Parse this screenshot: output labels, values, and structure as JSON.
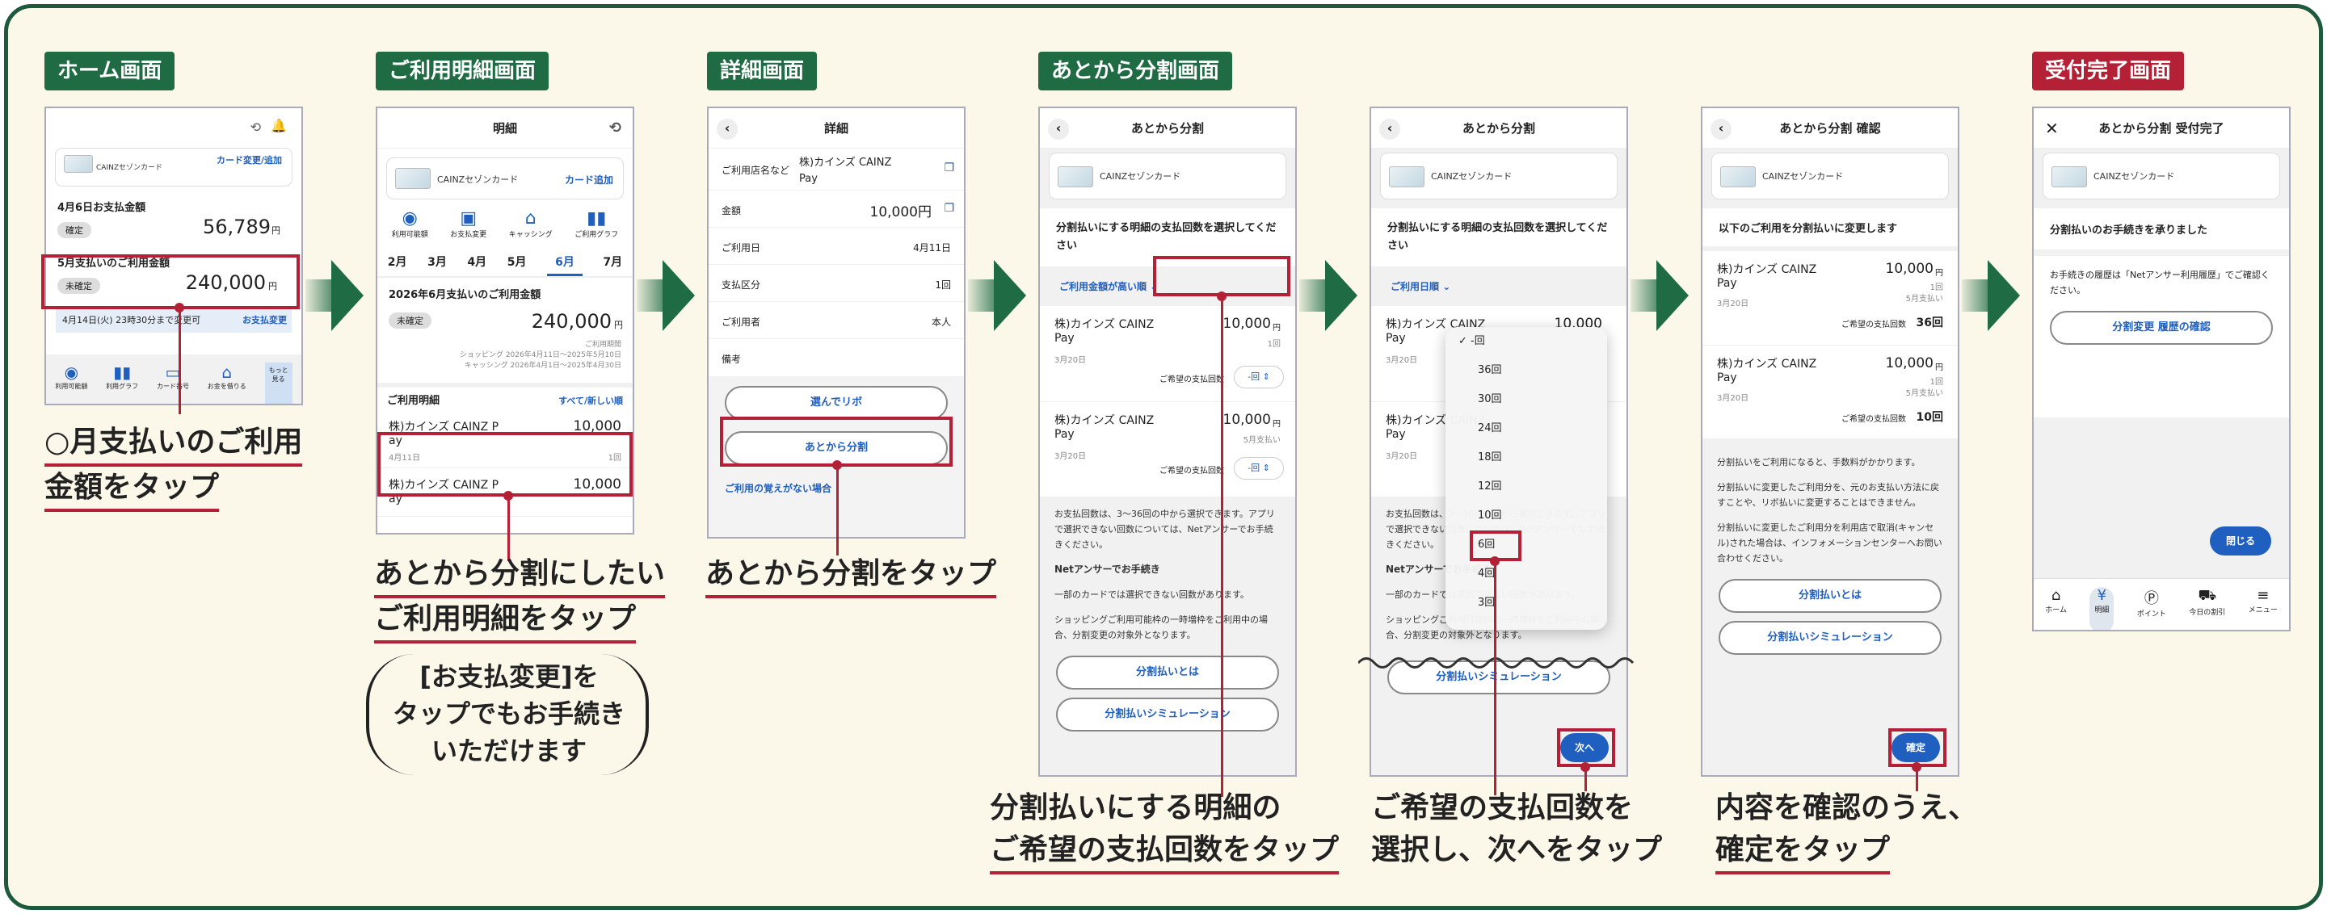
{
  "steps": [
    {
      "tag": "ホーム画面"
    },
    {
      "tag": "ご利用明細画面"
    },
    {
      "tag": "詳細画面"
    },
    {
      "tag": "あとから分割画面"
    },
    {
      "tag": ""
    },
    {
      "tag": ""
    },
    {
      "tag": "受付完了画面"
    }
  ],
  "home": {
    "card_name": "CAINZセゾンカード",
    "card_action": "カード変更/追加",
    "pay1_label": "4月6日お支払金額",
    "pay1_status": "確定",
    "pay1_amount": "56,789",
    "yen": "円",
    "pay2_label": "5月支払いのご利用金額",
    "pay2_status": "未確定",
    "pay2_amount": "240,000",
    "deadline": "4月14日(火) 23時30分まで変更可",
    "deadline_link": "お支払変更",
    "shortcuts": [
      "利用可能額",
      "利用グラフ",
      "カード番号",
      "お金を借りる",
      "もっと見る"
    ]
  },
  "list": {
    "title": "明細",
    "card_name": "CAINZセゾンカード",
    "card_add": "カード追加",
    "icons": [
      "利用可能額",
      "お支払変更",
      "キャッシング",
      "ご利用グラフ"
    ],
    "months": [
      "2月",
      "3月",
      "4月",
      "5月",
      "6月",
      "7月"
    ],
    "summary_title": "2026年6月支払いのご利用金額",
    "summary_status": "未確定",
    "summary_amount": "240,000",
    "period_label": "ご利用期間",
    "period1": "ショッピング 2026年4月11日〜2025年5月10日",
    "period2": "キャッシング 2026年4月1日〜2025年4月30日",
    "detail_head": "ご利用明細",
    "sort": "すべて/新しい順",
    "items": [
      {
        "name": "株)カインズ CAINZ P",
        "name2": "ay",
        "amount": "10,000",
        "date": "4月11日",
        "count": "1回"
      },
      {
        "name": "株)カインズ CAINZ P",
        "name2": "ay",
        "amount": "10,000",
        "date": "",
        "count": ""
      }
    ]
  },
  "detail": {
    "title": "詳細",
    "rows": [
      {
        "label": "ご利用店名など",
        "value": "株)カインズ CAINZ Pay"
      },
      {
        "label": "金額",
        "value": "10,000円"
      },
      {
        "label": "ご利用日",
        "value": "4月11日"
      },
      {
        "label": "支払区分",
        "value": "1回"
      },
      {
        "label": "ご利用者",
        "value": "本人"
      },
      {
        "label": "備考",
        "value": ""
      }
    ],
    "btn_revo": "選んでリボ",
    "btn_split": "あとから分割",
    "link_unknown": "ご利用の覚えがない場合"
  },
  "split": {
    "title": "あとから分割",
    "card_name": "CAINZセゾンカード",
    "instruction": "分割払いにする明細の支払回数を選択してください",
    "sort_amount": "ご利用金額が高い順",
    "sort_date": "ご利用日順",
    "items": [
      {
        "name": "株)カインズ CAINZ",
        "name2": "Pay",
        "amount": "10,000",
        "unit": "円",
        "count": "1回",
        "date": "3月20日",
        "select_label": "ご希望の支払回数",
        "select_value": "-回"
      },
      {
        "name": "株)カインズ CAINZ",
        "name2": "Pay",
        "amount": "10,000",
        "unit": "円",
        "count": "5月支払い",
        "date": "3月20日",
        "select_label": "ご希望の支払回数",
        "select_value": "-回"
      }
    ],
    "note1": "お支払回数は、3〜36回の中から選択できます。アプリで選択できない回数については、Netアンサーでお手続きください。",
    "net_link": "Netアンサーでお手続き",
    "note2": "一部のカードでは選択できない回数があります。",
    "note3": "ショッピングご利用可能枠の一時増枠をご利用中の場合、分割変更の対象外となります。",
    "btn_about": "分割払いとは",
    "btn_sim": "分割払いシミュレーション",
    "next": "次へ"
  },
  "picker": {
    "options": [
      "-回",
      "36回",
      "30回",
      "24回",
      "18回",
      "12回",
      "10回",
      "6回",
      "4回",
      "3回"
    ],
    "selected_index": 0,
    "highlight_index": 7,
    "check": "✓"
  },
  "confirm": {
    "title": "あとから分割 確認",
    "card_name": "CAINZセゾンカード",
    "lead": "以下のご利用を分割払いに変更します",
    "items": [
      {
        "name": "株)カインズ CAINZ",
        "name2": "Pay",
        "amount": "10,000",
        "unit": "円",
        "count": "1回",
        "sub": "5月支払い",
        "date": "3月20日",
        "sel_label": "ご希望の支払回数",
        "sel_value": "36回"
      },
      {
        "name": "株)カインズ CAINZ",
        "name2": "Pay",
        "amount": "10,000",
        "unit": "円",
        "count": "1回",
        "sub": "5月支払い",
        "date": "3月20日",
        "sel_label": "ご希望の支払回数",
        "sel_value": "10回"
      }
    ],
    "note1": "分割払いをご利用になると、手数料がかかります。",
    "note2": "分割払いに変更したご利用分を、元のお支払い方法に戻すことや、リボ払いに変更することはできません。",
    "note3": "分割払いに変更したご利用分を利用店で取消(キャンセル)された場合は、インフォメーションセンターへお問い合わせください。",
    "btn_about": "分割払いとは",
    "btn_sim": "分割払いシミュレーション",
    "ok": "確定"
  },
  "done": {
    "title": "あとから分割 受付完了",
    "card_name": "CAINZセゾンカード",
    "msg": "分割払いのお手続きを承りました",
    "note": "お手続きの履歴は「Netアンサー利用履歴」でご確認ください。",
    "btn_history": "分割変更 履歴の確認",
    "close": "閉じる",
    "tabs": [
      "ホーム",
      "明細",
      "ポイント",
      "今日の割引",
      "メニュー"
    ]
  },
  "captions": {
    "c1a": "○月支払いのご利用",
    "c1b": "金額をタップ",
    "c2a": "あとから分割にしたい",
    "c2b": "ご利用明細をタップ",
    "c2note1": "[お支払変更]を",
    "c2note2": "タップでもお手続き",
    "c2note3": "いただけます",
    "c3": "あとから分割をタップ",
    "c4a": "分割払いにする明細の",
    "c4b": "ご希望の支払回数をタップ",
    "c5a": "ご希望の支払回数を",
    "c5b": "選択し、次へをタップ",
    "c6a": "内容を確認のうえ、",
    "c6b": "確定をタップ"
  }
}
